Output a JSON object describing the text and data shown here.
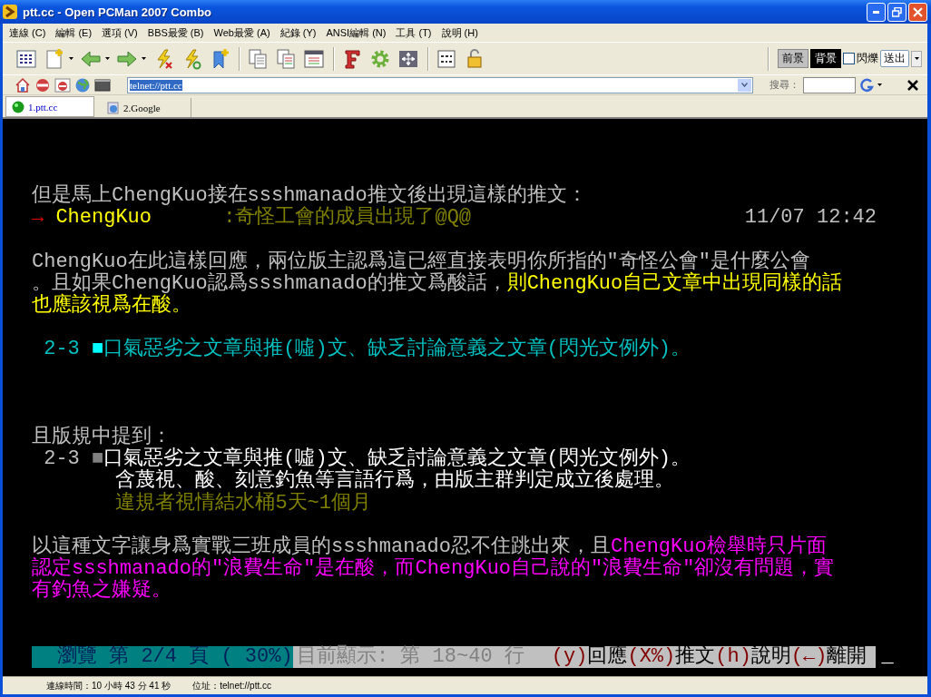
{
  "window": {
    "title": "ptt.cc - Open PCMan 2007 Combo"
  },
  "menu": [
    "連線 (C)",
    "編輯 (E)",
    "選項 (V)",
    "BBS最愛 (B)",
    "Web最愛 (A)",
    "紀錄 (Y)",
    "ANSI編輯 (N)",
    "工具 (T)",
    "說明 (H)"
  ],
  "color_controls": {
    "foreground": "前景",
    "background": "背景",
    "blink": {
      "label": "閃爍",
      "checked": false
    },
    "send": "送出"
  },
  "address_bar": {
    "value": "telnet://ptt.cc",
    "search_label": "搜尋："
  },
  "tabs": [
    {
      "label": "1.ptt.cc",
      "kind": "telnet",
      "selected": true
    },
    {
      "label": "2.Google",
      "kind": "web",
      "selected": false
    }
  ],
  "terminal": {
    "lines": [
      {
        "kind": "text",
        "segments": [
          {
            "text": "但是馬上ChengKuo接在ssshmanado推文後出現這樣的推文：",
            "color": "#c0c0c0"
          }
        ]
      },
      {
        "kind": "text",
        "segments": [
          {
            "text": "→",
            "color": "#e00000"
          },
          {
            "text": " ChengKuo      ",
            "color": "#ffff00"
          },
          {
            "text": ":奇怪工會的成員出現了@Q@",
            "color": "#808000"
          }
        ],
        "time": "11/07 12:42"
      },
      {
        "kind": "blank"
      },
      {
        "kind": "text",
        "segments": [
          {
            "text": "ChengKuo在此這樣回應，兩位版主認爲這已經直接表明你所指的\"奇怪公會\"是什麼公會",
            "color": "#c0c0c0"
          }
        ]
      },
      {
        "kind": "text",
        "segments": [
          {
            "text": "。且如果ChengKuo認爲ssshmanado的推文爲酸話，",
            "color": "#c0c0c0"
          },
          {
            "text": "則ChengKuo自己文章中出現同樣的話",
            "color": "#ffff00"
          }
        ]
      },
      {
        "kind": "text",
        "segments": [
          {
            "text": "也應該視爲在酸。",
            "color": "#ffff00"
          }
        ]
      },
      {
        "kind": "blank"
      },
      {
        "kind": "text",
        "segments": [
          {
            "text": " 2-3 ",
            "color": "#00c0c0"
          },
          {
            "text": "■",
            "color": "#00ffff"
          },
          {
            "text": "口氣惡劣之文章與推(噓)文、缺乏討論意義之文章(閃光文例外)。",
            "color": "#00c0c0"
          }
        ]
      },
      {
        "kind": "blank"
      },
      {
        "kind": "blank"
      },
      {
        "kind": "blank"
      },
      {
        "kind": "text",
        "segments": [
          {
            "text": "且版規中提到：",
            "color": "#c0c0c0"
          }
        ]
      },
      {
        "kind": "text",
        "segments": [
          {
            "text": " 2-3 ",
            "color": "#c0c0c0"
          },
          {
            "text": "■",
            "color": "#808080"
          },
          {
            "text": "口氣惡劣之文章與推(噓)文、缺乏討論意義之文章(閃光文例外)。",
            "color": "#ffffff"
          }
        ]
      },
      {
        "kind": "text",
        "segments": [
          {
            "text": "       含蔑視、酸、刻意釣魚等言語行爲，由版主群判定成立後處理。",
            "color": "#ffffff"
          }
        ]
      },
      {
        "kind": "text",
        "segments": [
          {
            "text": "       違規者視情結水桶5天~1個月",
            "color": "#808000"
          }
        ]
      },
      {
        "kind": "blank"
      },
      {
        "kind": "text",
        "segments": [
          {
            "text": "以這種文字讓身爲實戰三班成員的ssshmanado忍不住跳出來，且",
            "color": "#c0c0c0"
          },
          {
            "text": "ChengKuo檢舉時只片面",
            "color": "#ff00ff"
          }
        ]
      },
      {
        "kind": "text",
        "segments": [
          {
            "text": "認定ssshmanado的\"浪費生命\"是在酸，而ChengKuo自己說的\"浪費生命\"卻沒有問題，實",
            "color": "#ff00ff"
          }
        ]
      },
      {
        "kind": "text",
        "segments": [
          {
            "text": "有釣魚之嫌疑。",
            "color": "#ff00ff"
          }
        ]
      },
      {
        "kind": "blank"
      },
      {
        "kind": "blank"
      },
      {
        "kind": "status",
        "blocks": [
          {
            "color": "#008080",
            "segments": [
              {
                "text": "瀏覽 第 2/4 頁 ( 30%)"
              }
            ]
          },
          {
            "color": "#c0c0c0",
            "segments": [
              {
                "text": "目前顯示: 第 18~40 行",
                "color": "#808080"
              },
              {
                "text": "(y)",
                "color": "#800000"
              },
              {
                "text": "回應",
                "color": "#000000"
              },
              {
                "text": "(X%)",
                "color": "#800000"
              },
              {
                "text": "推文",
                "color": "#000000"
              },
              {
                "text": "(h)",
                "color": "#800000"
              },
              {
                "text": "說明",
                "color": "#000000"
              },
              {
                "text": "(←)",
                "color": "#800000"
              },
              {
                "text": "離開",
                "color": "#000000"
              }
            ]
          }
        ],
        "cursor": "_"
      }
    ]
  },
  "status_bar": {
    "connection_time": "連線時間：10 小時 43 分 41 秒",
    "address": "位址：telnet://ptt.cc"
  }
}
